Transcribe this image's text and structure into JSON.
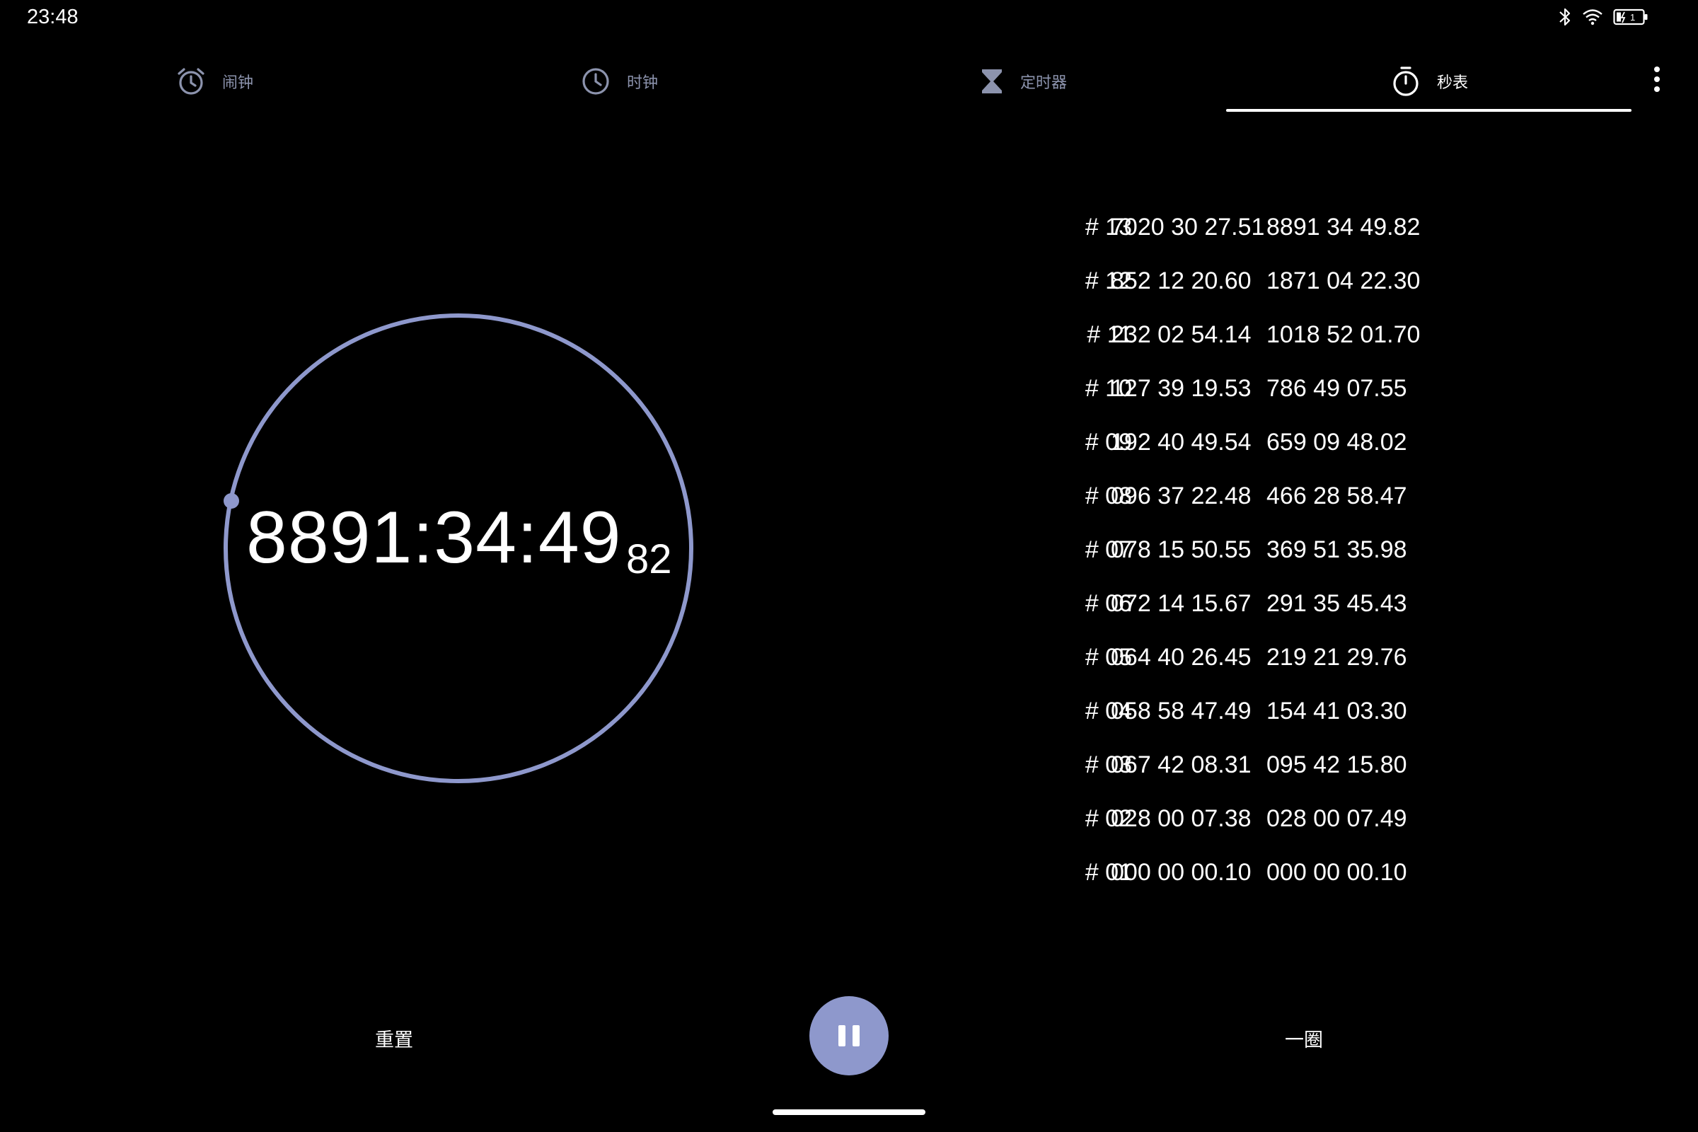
{
  "status": {
    "time": "23:48",
    "battery_level": "1"
  },
  "colors": {
    "accent": "#8e98cc",
    "background": "#000000",
    "inactive_tab": "#8c93ad"
  },
  "tabs": [
    {
      "icon": "alarm-icon",
      "label": "闹钟",
      "active": false
    },
    {
      "icon": "clock-icon",
      "label": "时钟",
      "active": false
    },
    {
      "icon": "hourglass-icon",
      "label": "定时器",
      "active": false
    },
    {
      "icon": "stopwatch-icon",
      "label": "秒表",
      "active": true
    }
  ],
  "stopwatch": {
    "time": "8891:34:49",
    "hundredths": "82"
  },
  "laps": [
    {
      "no": "# 13",
      "lap": "7020 30 27.51",
      "total": "8891 34 49.82"
    },
    {
      "no": "# 12",
      "lap": "852 12 20.60",
      "total": "1871 04 22.30"
    },
    {
      "no": "# 11",
      "lap": "232 02 54.14",
      "total": "1018 52 01.70"
    },
    {
      "no": "# 10",
      "lap": "127 39 19.53",
      "total": "786 49 07.55"
    },
    {
      "no": "# 09",
      "lap": "192 40 49.54",
      "total": "659 09 48.02"
    },
    {
      "no": "# 08",
      "lap": "096 37 22.48",
      "total": "466 28 58.47"
    },
    {
      "no": "# 07",
      "lap": "078 15 50.55",
      "total": "369 51 35.98"
    },
    {
      "no": "# 06",
      "lap": "072 14 15.67",
      "total": "291 35 45.43"
    },
    {
      "no": "# 05",
      "lap": "064 40 26.45",
      "total": "219 21 29.76"
    },
    {
      "no": "# 04",
      "lap": "058 58 47.49",
      "total": "154 41 03.30"
    },
    {
      "no": "# 03",
      "lap": "067 42 08.31",
      "total": "095 42 15.80"
    },
    {
      "no": "# 02",
      "lap": "028 00 07.38",
      "total": "028 00 07.49"
    },
    {
      "no": "# 01",
      "lap": "000 00 00.10",
      "total": "000 00 00.10"
    }
  ],
  "controls": {
    "reset_label": "重置",
    "lap_label": "一圈",
    "pause_icon": "pause-icon"
  }
}
